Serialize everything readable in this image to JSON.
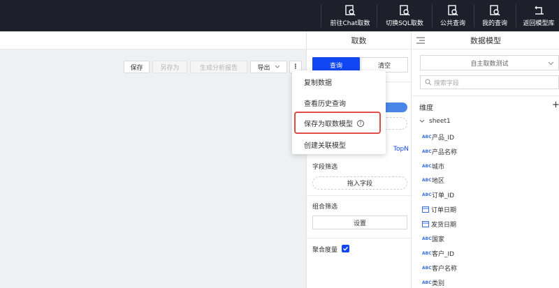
{
  "nav": {
    "items": [
      {
        "label": "前往Chat取数",
        "icon": "chat-query-icon"
      },
      {
        "label": "切换SQL取数",
        "icon": "sql-query-icon"
      },
      {
        "label": "公共查询",
        "icon": "public-query-icon"
      },
      {
        "label": "我的查询",
        "icon": "my-query-icon"
      },
      {
        "label": "返回模型库",
        "icon": "return-icon"
      }
    ]
  },
  "toolbar": {
    "save_label": "保存",
    "save_as_label": "另存为",
    "generate_report_label": "生成分析报告",
    "export_label": "导出",
    "more_label": "⋮"
  },
  "menu": {
    "items": [
      "复制数据",
      "查看历史查询",
      "保存为取数模型",
      "创建关联模型"
    ]
  },
  "query_panel": {
    "title": "取数",
    "query_label": "查询",
    "clear_label": "清空",
    "topn_label": "TopN",
    "field_filter_label": "字段筛选",
    "drag_field_label": "拖入字段",
    "combo_filter_label": "组合筛选",
    "settings_label": "设置",
    "aggregate_label": "聚合度量",
    "aggregate_checked": true
  },
  "model_panel": {
    "title": "数据模型",
    "selected_model": "自主取数测试",
    "search_placeholder": "搜索字段",
    "dimension_label": "维度",
    "sheet_name": "sheet1",
    "fields": [
      {
        "name": "产品_ID",
        "type": "text"
      },
      {
        "name": "产品名称",
        "type": "text"
      },
      {
        "name": "城市",
        "type": "text"
      },
      {
        "name": "地区",
        "type": "text"
      },
      {
        "name": "订单_ID",
        "type": "text"
      },
      {
        "name": "订单日期",
        "type": "date"
      },
      {
        "name": "发货日期",
        "type": "date"
      },
      {
        "name": "国家",
        "type": "text"
      },
      {
        "name": "客户_ID",
        "type": "text"
      },
      {
        "name": "客户名称",
        "type": "text"
      },
      {
        "name": "类别",
        "type": "text"
      }
    ],
    "abc_label": "ABC"
  },
  "colors": {
    "nav_bg": "#1d1f2b",
    "primary": "#1146f5",
    "highlight": "#e04b45"
  }
}
